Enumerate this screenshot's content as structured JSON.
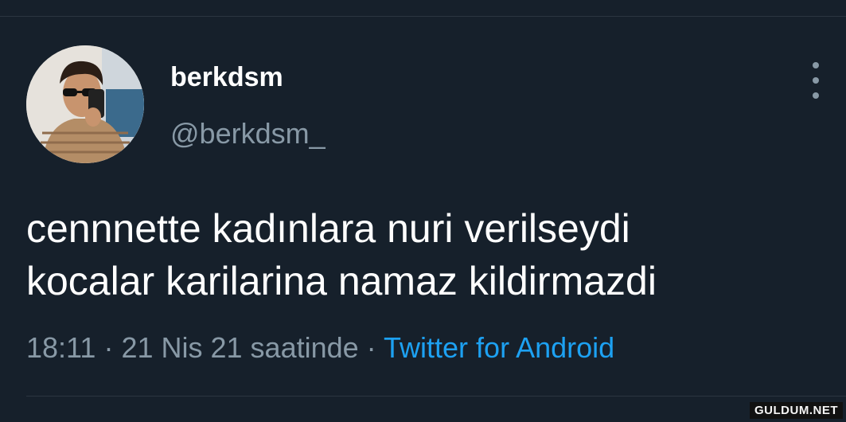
{
  "profile": {
    "display_name": "berkdsm",
    "handle": "@berkdsm_"
  },
  "tweet": {
    "lines": [
      "cennnette kadınlara nuri verilseydi",
      "kocalar karilarina namaz kildirmazdi"
    ],
    "time": "18:11",
    "date": "21 Nis 21 saatinde",
    "separator": "·",
    "source": "Twitter for Android"
  },
  "icons": {
    "more": "more-vertical-icon"
  },
  "watermark": "GULDUM.NET",
  "colors": {
    "background": "#16202b",
    "text": "#ffffff",
    "secondary": "#8899a6",
    "link": "#1da1f2"
  }
}
